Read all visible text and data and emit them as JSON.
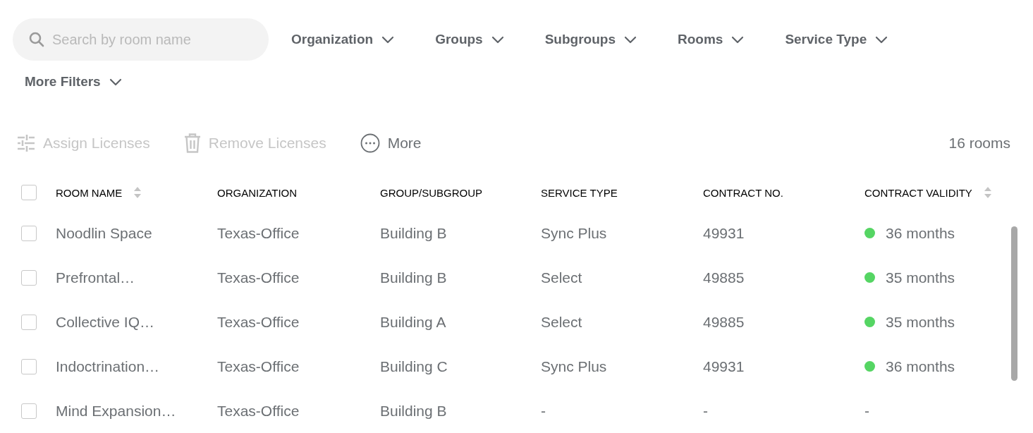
{
  "search": {
    "placeholder": "Search by room name"
  },
  "filters": [
    {
      "label": "Organization"
    },
    {
      "label": "Groups"
    },
    {
      "label": "Subgroups"
    },
    {
      "label": "Rooms"
    },
    {
      "label": "Service Type"
    },
    {
      "label": "More Filters"
    }
  ],
  "actions": [
    {
      "kind": "assign",
      "label": "Assign Licenses",
      "disabled": true
    },
    {
      "kind": "remove",
      "label": "Remove Licenses",
      "disabled": true
    },
    {
      "kind": "more",
      "label": "More",
      "disabled": false
    }
  ],
  "room_count": "16 rooms",
  "table": {
    "select_all": {
      "checked": false
    },
    "columns": [
      {
        "label": "ROOM NAME",
        "sortable": true
      },
      {
        "label": "ORGANIZATION",
        "sortable": false
      },
      {
        "label": "GROUP/SUBGROUP",
        "sortable": false
      },
      {
        "label": "SERVICE TYPE",
        "sortable": false
      },
      {
        "label": "CONTRACT NO.",
        "sortable": false
      },
      {
        "label": "CONTRACT VALIDITY",
        "sortable": true
      }
    ],
    "rows": [
      {
        "checked": false,
        "cells": [
          "Noodlin Space",
          "Texas-Office",
          "Building B",
          "Sync Plus",
          "49931",
          "36 months"
        ],
        "color": "#55d563"
      },
      {
        "checked": false,
        "cells": [
          "Prefrontal…",
          "Texas-Office",
          "Building B",
          "Select",
          "49885",
          "35 months"
        ],
        "color": "#55d563"
      },
      {
        "checked": false,
        "cells": [
          "Collective IQ…",
          "Texas-Office",
          "Building A",
          "Select",
          "49885",
          "35 months"
        ],
        "color": "#55d563"
      },
      {
        "checked": false,
        "cells": [
          "Indoctrination…",
          "Texas-Office",
          "Building C",
          "Sync Plus",
          "49931",
          "36 months"
        ],
        "color": "#55d563"
      },
      {
        "checked": false,
        "cells": [
          "Mind Expansion…",
          "Texas-Office",
          "Building B",
          "-",
          "-",
          "-"
        ]
      }
    ]
  }
}
